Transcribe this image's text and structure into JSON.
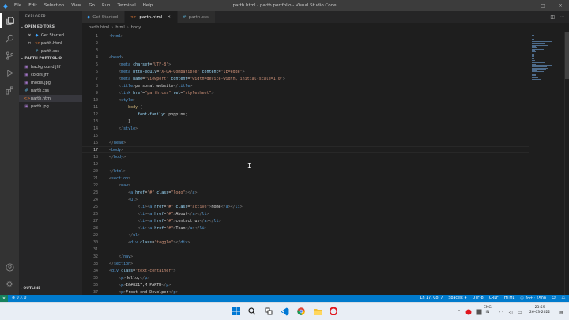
{
  "window": {
    "title": "parth.html - parth portfolio - Visual Studio Code",
    "menu": [
      "File",
      "Edit",
      "Selection",
      "View",
      "Go",
      "Run",
      "Terminal",
      "Help"
    ]
  },
  "sidebar": {
    "title": "EXPLORER",
    "open_editors": {
      "label": "OPEN EDITORS",
      "items": [
        {
          "name": "Get Started",
          "marker": "✕"
        },
        {
          "name": "parth.html",
          "marker": "✕"
        },
        {
          "name": "parth.css",
          "marker": ""
        }
      ]
    },
    "folder": {
      "label": "PARTH PORTFOLIO",
      "items": [
        "background.jfif",
        "colors.jfif",
        "model.jpg",
        "parth.css",
        "parth.html",
        "parth.jpg"
      ]
    },
    "outline_label": "OUTLINE"
  },
  "tabs": [
    {
      "label": "Get Started",
      "icon": "vscode-icon",
      "active": false
    },
    {
      "label": "parth.html",
      "icon": "html-icon",
      "active": true
    },
    {
      "label": "parth.css",
      "icon": "css-icon",
      "active": false
    }
  ],
  "breadcrumb": [
    "parth.html",
    "html",
    "body"
  ],
  "editor": {
    "current_line": 17,
    "lines": [
      {
        "n": 1,
        "segs": [
          [
            "t-punc",
            "<"
          ],
          [
            "t-tag",
            "html"
          ],
          [
            "t-punc",
            ">"
          ]
        ]
      },
      {
        "n": 2,
        "segs": []
      },
      {
        "n": 3,
        "segs": []
      },
      {
        "n": 4,
        "segs": [
          [
            "t-punc",
            "<"
          ],
          [
            "t-tag",
            "head"
          ],
          [
            "t-punc",
            ">"
          ]
        ]
      },
      {
        "n": 5,
        "segs": [
          [
            "t-txt",
            "    "
          ],
          [
            "t-punc",
            "<"
          ],
          [
            "t-tag",
            "meta "
          ],
          [
            "t-attr",
            "charset"
          ],
          [
            "t-txt",
            "="
          ],
          [
            "t-str",
            "\"UTF-8\""
          ],
          [
            "t-punc",
            ">"
          ]
        ]
      },
      {
        "n": 6,
        "segs": [
          [
            "t-txt",
            "    "
          ],
          [
            "t-punc",
            "<"
          ],
          [
            "t-tag",
            "meta "
          ],
          [
            "t-attr",
            "http-equiv"
          ],
          [
            "t-txt",
            "="
          ],
          [
            "t-str",
            "\"X-UA-Compatible\" "
          ],
          [
            "t-attr",
            "content"
          ],
          [
            "t-txt",
            "="
          ],
          [
            "t-str",
            "\"IE=edge\""
          ],
          [
            "t-punc",
            ">"
          ]
        ]
      },
      {
        "n": 7,
        "segs": [
          [
            "t-txt",
            "    "
          ],
          [
            "t-punc",
            "<"
          ],
          [
            "t-tag",
            "meta "
          ],
          [
            "t-attr",
            "name"
          ],
          [
            "t-txt",
            "="
          ],
          [
            "t-str",
            "\"viewport\" "
          ],
          [
            "t-attr",
            "content"
          ],
          [
            "t-txt",
            "="
          ],
          [
            "t-str",
            "\"width=device-width, initial-scale=1.0\""
          ],
          [
            "t-punc",
            ">"
          ]
        ]
      },
      {
        "n": 8,
        "segs": [
          [
            "t-txt",
            "    "
          ],
          [
            "t-punc",
            "<"
          ],
          [
            "t-tag",
            "title"
          ],
          [
            "t-punc",
            ">"
          ],
          [
            "t-txt",
            "personal website"
          ],
          [
            "t-punc",
            "</"
          ],
          [
            "t-tag",
            "title"
          ],
          [
            "t-punc",
            ">"
          ]
        ]
      },
      {
        "n": 9,
        "segs": [
          [
            "t-txt",
            "    "
          ],
          [
            "t-punc",
            "<"
          ],
          [
            "t-tag",
            "link "
          ],
          [
            "t-attr",
            "href"
          ],
          [
            "t-txt",
            "="
          ],
          [
            "t-str",
            "\"parth.css\" "
          ],
          [
            "t-attr",
            "rel"
          ],
          [
            "t-txt",
            "="
          ],
          [
            "t-str",
            "\"stylesheet\""
          ],
          [
            "t-punc",
            ">"
          ]
        ]
      },
      {
        "n": 10,
        "segs": [
          [
            "t-txt",
            "    "
          ],
          [
            "t-punc",
            "<"
          ],
          [
            "t-tag",
            "style"
          ],
          [
            "t-punc",
            ">"
          ]
        ]
      },
      {
        "n": 11,
        "segs": [
          [
            "t-txt",
            "        "
          ],
          [
            "t-sel",
            "body "
          ],
          [
            "t-txt",
            "{"
          ]
        ]
      },
      {
        "n": 12,
        "segs": [
          [
            "t-txt",
            "            "
          ],
          [
            "t-prop",
            "font-family"
          ],
          [
            "t-txt",
            ": poppins;"
          ]
        ]
      },
      {
        "n": 13,
        "segs": [
          [
            "t-txt",
            "        "
          ],
          [
            "t-txt",
            "}"
          ]
        ]
      },
      {
        "n": 14,
        "segs": [
          [
            "t-txt",
            "    "
          ],
          [
            "t-punc",
            "</"
          ],
          [
            "t-tag",
            "style"
          ],
          [
            "t-punc",
            ">"
          ]
        ]
      },
      {
        "n": 15,
        "segs": []
      },
      {
        "n": 16,
        "segs": [
          [
            "t-punc",
            "</"
          ],
          [
            "t-tag",
            "head"
          ],
          [
            "t-punc",
            ">"
          ]
        ]
      },
      {
        "n": 17,
        "segs": [
          [
            "t-punc",
            "<"
          ],
          [
            "t-tag",
            "body"
          ],
          [
            "t-punc",
            ">"
          ]
        ]
      },
      {
        "n": 18,
        "segs": [
          [
            "t-punc",
            "</"
          ],
          [
            "t-tag",
            "body"
          ],
          [
            "t-punc",
            ">"
          ]
        ]
      },
      {
        "n": 19,
        "segs": []
      },
      {
        "n": 20,
        "segs": [
          [
            "t-punc",
            "</"
          ],
          [
            "t-tag",
            "html"
          ],
          [
            "t-punc",
            ">"
          ]
        ]
      },
      {
        "n": 21,
        "segs": [
          [
            "t-punc",
            "<"
          ],
          [
            "t-tag",
            "section"
          ],
          [
            "t-punc",
            ">"
          ]
        ]
      },
      {
        "n": 22,
        "segs": [
          [
            "t-txt",
            "    "
          ],
          [
            "t-punc",
            "<"
          ],
          [
            "t-tag",
            "nav"
          ],
          [
            "t-punc",
            ">"
          ]
        ]
      },
      {
        "n": 23,
        "segs": [
          [
            "t-txt",
            "        "
          ],
          [
            "t-punc",
            "<"
          ],
          [
            "t-tag",
            "a "
          ],
          [
            "t-attr",
            "href"
          ],
          [
            "t-txt",
            "="
          ],
          [
            "t-str",
            "\"#\" "
          ],
          [
            "t-attr",
            "class"
          ],
          [
            "t-txt",
            "="
          ],
          [
            "t-str",
            "\"logo\""
          ],
          [
            "t-punc",
            "></"
          ],
          [
            "t-tag",
            "a"
          ],
          [
            "t-punc",
            ">"
          ]
        ]
      },
      {
        "n": 24,
        "segs": [
          [
            "t-txt",
            "        "
          ],
          [
            "t-punc",
            "<"
          ],
          [
            "t-tag",
            "ul"
          ],
          [
            "t-punc",
            ">"
          ]
        ]
      },
      {
        "n": 25,
        "segs": [
          [
            "t-txt",
            "            "
          ],
          [
            "t-punc",
            "<"
          ],
          [
            "t-tag",
            "li"
          ],
          [
            "t-punc",
            "><"
          ],
          [
            "t-tag",
            "a "
          ],
          [
            "t-attr",
            "href"
          ],
          [
            "t-txt",
            "="
          ],
          [
            "t-str",
            "\"#\" "
          ],
          [
            "t-attr",
            "class"
          ],
          [
            "t-txt",
            "="
          ],
          [
            "t-str",
            "\"active\""
          ],
          [
            "t-punc",
            ">"
          ],
          [
            "t-txt",
            "Home"
          ],
          [
            "t-punc",
            "</"
          ],
          [
            "t-tag",
            "a"
          ],
          [
            "t-punc",
            "></"
          ],
          [
            "t-tag",
            "li"
          ],
          [
            "t-punc",
            ">"
          ]
        ]
      },
      {
        "n": 26,
        "segs": [
          [
            "t-txt",
            "            "
          ],
          [
            "t-punc",
            "<"
          ],
          [
            "t-tag",
            "li"
          ],
          [
            "t-punc",
            "><"
          ],
          [
            "t-tag",
            "a "
          ],
          [
            "t-attr",
            "href"
          ],
          [
            "t-txt",
            "="
          ],
          [
            "t-str",
            "\"#\""
          ],
          [
            "t-punc",
            ">"
          ],
          [
            "t-txt",
            "About"
          ],
          [
            "t-punc",
            "</"
          ],
          [
            "t-tag",
            "a"
          ],
          [
            "t-punc",
            "></"
          ],
          [
            "t-tag",
            "li"
          ],
          [
            "t-punc",
            ">"
          ]
        ]
      },
      {
        "n": 27,
        "segs": [
          [
            "t-txt",
            "            "
          ],
          [
            "t-punc",
            "<"
          ],
          [
            "t-tag",
            "li"
          ],
          [
            "t-punc",
            "><"
          ],
          [
            "t-tag",
            "a "
          ],
          [
            "t-attr",
            "href"
          ],
          [
            "t-txt",
            "="
          ],
          [
            "t-str",
            "\"#\""
          ],
          [
            "t-punc",
            ">"
          ],
          [
            "t-txt",
            "contact us"
          ],
          [
            "t-punc",
            "</"
          ],
          [
            "t-tag",
            "a"
          ],
          [
            "t-punc",
            "></"
          ],
          [
            "t-tag",
            "li"
          ],
          [
            "t-punc",
            ">"
          ]
        ]
      },
      {
        "n": 28,
        "segs": [
          [
            "t-txt",
            "            "
          ],
          [
            "t-punc",
            "<"
          ],
          [
            "t-tag",
            "li"
          ],
          [
            "t-punc",
            "><"
          ],
          [
            "t-tag",
            "a "
          ],
          [
            "t-attr",
            "href"
          ],
          [
            "t-txt",
            "="
          ],
          [
            "t-str",
            "\"#\""
          ],
          [
            "t-punc",
            ">"
          ],
          [
            "t-txt",
            "Team"
          ],
          [
            "t-punc",
            "</"
          ],
          [
            "t-tag",
            "a"
          ],
          [
            "t-punc",
            "></"
          ],
          [
            "t-tag",
            "li"
          ],
          [
            "t-punc",
            ">"
          ]
        ]
      },
      {
        "n": 29,
        "segs": [
          [
            "t-txt",
            "        "
          ],
          [
            "t-punc",
            "</"
          ],
          [
            "t-tag",
            "ul"
          ],
          [
            "t-punc",
            ">"
          ]
        ]
      },
      {
        "n": 30,
        "segs": [
          [
            "t-txt",
            "        "
          ],
          [
            "t-punc",
            "<"
          ],
          [
            "t-tag",
            "div "
          ],
          [
            "t-attr",
            "class"
          ],
          [
            "t-txt",
            "="
          ],
          [
            "t-str",
            "\"toggle\""
          ],
          [
            "t-punc",
            "></"
          ],
          [
            "t-tag",
            "div"
          ],
          [
            "t-punc",
            ">"
          ]
        ]
      },
      {
        "n": 31,
        "segs": []
      },
      {
        "n": 32,
        "segs": [
          [
            "t-txt",
            "    "
          ],
          [
            "t-punc",
            "</"
          ],
          [
            "t-tag",
            "nav"
          ],
          [
            "t-punc",
            ">"
          ]
        ]
      },
      {
        "n": 33,
        "segs": [
          [
            "t-punc",
            "</"
          ],
          [
            "t-tag",
            "section"
          ],
          [
            "t-punc",
            ">"
          ]
        ]
      },
      {
        "n": 34,
        "segs": [
          [
            "t-punc",
            "<"
          ],
          [
            "t-tag",
            "div "
          ],
          [
            "t-attr",
            "class"
          ],
          [
            "t-txt",
            "="
          ],
          [
            "t-str",
            "\"text-container\""
          ],
          [
            "t-punc",
            ">"
          ]
        ]
      },
      {
        "n": 35,
        "segs": [
          [
            "t-txt",
            "    "
          ],
          [
            "t-punc",
            "<"
          ],
          [
            "t-tag",
            "p"
          ],
          [
            "t-punc",
            ">"
          ],
          [
            "t-txt",
            "Hello,"
          ],
          [
            "t-punc",
            "</"
          ],
          [
            "t-tag",
            "p"
          ],
          [
            "t-punc",
            ">"
          ]
        ]
      },
      {
        "n": 36,
        "segs": [
          [
            "t-txt",
            "    "
          ],
          [
            "t-punc",
            "<"
          ],
          [
            "t-tag",
            "p"
          ],
          [
            "t-punc",
            ">"
          ],
          [
            "t-txt",
            "I&#8217;M PARTH"
          ],
          [
            "t-punc",
            "</"
          ],
          [
            "t-tag",
            "p"
          ],
          [
            "t-punc",
            ">"
          ]
        ]
      },
      {
        "n": 37,
        "segs": [
          [
            "t-txt",
            "    "
          ],
          [
            "t-punc",
            "<"
          ],
          [
            "t-tag",
            "p"
          ],
          [
            "t-punc",
            ">"
          ],
          [
            "t-txt",
            "Front end Devolper"
          ],
          [
            "t-punc",
            "</"
          ],
          [
            "t-tag",
            "p"
          ],
          [
            "t-punc",
            ">"
          ]
        ]
      }
    ]
  },
  "statusbar": {
    "errors": "0",
    "warnings": "0",
    "position": "Ln 17, Col 7",
    "spaces": "Spaces: 4",
    "encoding": "UTF-8",
    "eol": "CRLF",
    "language": "HTML",
    "port": "Port : 5500"
  },
  "taskbar": {
    "lang_top": "ENG",
    "lang_bottom": "IN",
    "time": "23:59",
    "date": "26-03-2022"
  },
  "colors": {
    "statusbar": "#007acc",
    "activitybar": "#333333",
    "sidebar": "#252526",
    "editor": "#1e1e1e",
    "titlebar": "#3c3c3c"
  }
}
